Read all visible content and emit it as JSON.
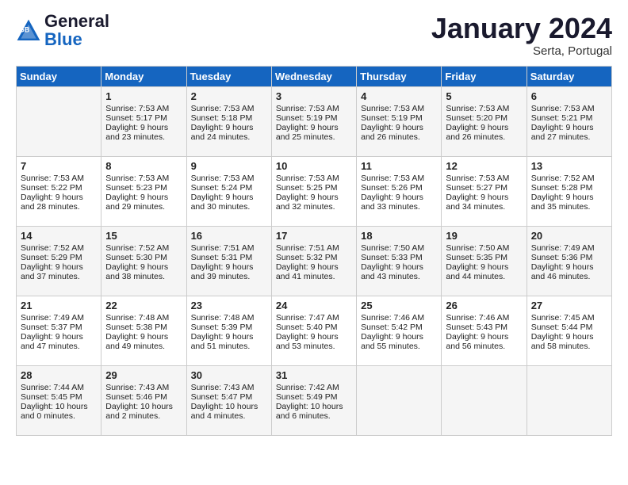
{
  "header": {
    "logo_general": "General",
    "logo_blue": "Blue",
    "month_title": "January 2024",
    "location": "Serta, Portugal"
  },
  "weekdays": [
    "Sunday",
    "Monday",
    "Tuesday",
    "Wednesday",
    "Thursday",
    "Friday",
    "Saturday"
  ],
  "weeks": [
    [
      {
        "day": "",
        "sunrise": "",
        "sunset": "",
        "daylight": ""
      },
      {
        "day": "1",
        "sunrise": "Sunrise: 7:53 AM",
        "sunset": "Sunset: 5:17 PM",
        "daylight": "Daylight: 9 hours and 23 minutes."
      },
      {
        "day": "2",
        "sunrise": "Sunrise: 7:53 AM",
        "sunset": "Sunset: 5:18 PM",
        "daylight": "Daylight: 9 hours and 24 minutes."
      },
      {
        "day": "3",
        "sunrise": "Sunrise: 7:53 AM",
        "sunset": "Sunset: 5:19 PM",
        "daylight": "Daylight: 9 hours and 25 minutes."
      },
      {
        "day": "4",
        "sunrise": "Sunrise: 7:53 AM",
        "sunset": "Sunset: 5:19 PM",
        "daylight": "Daylight: 9 hours and 26 minutes."
      },
      {
        "day": "5",
        "sunrise": "Sunrise: 7:53 AM",
        "sunset": "Sunset: 5:20 PM",
        "daylight": "Daylight: 9 hours and 26 minutes."
      },
      {
        "day": "6",
        "sunrise": "Sunrise: 7:53 AM",
        "sunset": "Sunset: 5:21 PM",
        "daylight": "Daylight: 9 hours and 27 minutes."
      }
    ],
    [
      {
        "day": "7",
        "sunrise": "Sunrise: 7:53 AM",
        "sunset": "Sunset: 5:22 PM",
        "daylight": "Daylight: 9 hours and 28 minutes."
      },
      {
        "day": "8",
        "sunrise": "Sunrise: 7:53 AM",
        "sunset": "Sunset: 5:23 PM",
        "daylight": "Daylight: 9 hours and 29 minutes."
      },
      {
        "day": "9",
        "sunrise": "Sunrise: 7:53 AM",
        "sunset": "Sunset: 5:24 PM",
        "daylight": "Daylight: 9 hours and 30 minutes."
      },
      {
        "day": "10",
        "sunrise": "Sunrise: 7:53 AM",
        "sunset": "Sunset: 5:25 PM",
        "daylight": "Daylight: 9 hours and 32 minutes."
      },
      {
        "day": "11",
        "sunrise": "Sunrise: 7:53 AM",
        "sunset": "Sunset: 5:26 PM",
        "daylight": "Daylight: 9 hours and 33 minutes."
      },
      {
        "day": "12",
        "sunrise": "Sunrise: 7:53 AM",
        "sunset": "Sunset: 5:27 PM",
        "daylight": "Daylight: 9 hours and 34 minutes."
      },
      {
        "day": "13",
        "sunrise": "Sunrise: 7:52 AM",
        "sunset": "Sunset: 5:28 PM",
        "daylight": "Daylight: 9 hours and 35 minutes."
      }
    ],
    [
      {
        "day": "14",
        "sunrise": "Sunrise: 7:52 AM",
        "sunset": "Sunset: 5:29 PM",
        "daylight": "Daylight: 9 hours and 37 minutes."
      },
      {
        "day": "15",
        "sunrise": "Sunrise: 7:52 AM",
        "sunset": "Sunset: 5:30 PM",
        "daylight": "Daylight: 9 hours and 38 minutes."
      },
      {
        "day": "16",
        "sunrise": "Sunrise: 7:51 AM",
        "sunset": "Sunset: 5:31 PM",
        "daylight": "Daylight: 9 hours and 39 minutes."
      },
      {
        "day": "17",
        "sunrise": "Sunrise: 7:51 AM",
        "sunset": "Sunset: 5:32 PM",
        "daylight": "Daylight: 9 hours and 41 minutes."
      },
      {
        "day": "18",
        "sunrise": "Sunrise: 7:50 AM",
        "sunset": "Sunset: 5:33 PM",
        "daylight": "Daylight: 9 hours and 43 minutes."
      },
      {
        "day": "19",
        "sunrise": "Sunrise: 7:50 AM",
        "sunset": "Sunset: 5:35 PM",
        "daylight": "Daylight: 9 hours and 44 minutes."
      },
      {
        "day": "20",
        "sunrise": "Sunrise: 7:49 AM",
        "sunset": "Sunset: 5:36 PM",
        "daylight": "Daylight: 9 hours and 46 minutes."
      }
    ],
    [
      {
        "day": "21",
        "sunrise": "Sunrise: 7:49 AM",
        "sunset": "Sunset: 5:37 PM",
        "daylight": "Daylight: 9 hours and 47 minutes."
      },
      {
        "day": "22",
        "sunrise": "Sunrise: 7:48 AM",
        "sunset": "Sunset: 5:38 PM",
        "daylight": "Daylight: 9 hours and 49 minutes."
      },
      {
        "day": "23",
        "sunrise": "Sunrise: 7:48 AM",
        "sunset": "Sunset: 5:39 PM",
        "daylight": "Daylight: 9 hours and 51 minutes."
      },
      {
        "day": "24",
        "sunrise": "Sunrise: 7:47 AM",
        "sunset": "Sunset: 5:40 PM",
        "daylight": "Daylight: 9 hours and 53 minutes."
      },
      {
        "day": "25",
        "sunrise": "Sunrise: 7:46 AM",
        "sunset": "Sunset: 5:42 PM",
        "daylight": "Daylight: 9 hours and 55 minutes."
      },
      {
        "day": "26",
        "sunrise": "Sunrise: 7:46 AM",
        "sunset": "Sunset: 5:43 PM",
        "daylight": "Daylight: 9 hours and 56 minutes."
      },
      {
        "day": "27",
        "sunrise": "Sunrise: 7:45 AM",
        "sunset": "Sunset: 5:44 PM",
        "daylight": "Daylight: 9 hours and 58 minutes."
      }
    ],
    [
      {
        "day": "28",
        "sunrise": "Sunrise: 7:44 AM",
        "sunset": "Sunset: 5:45 PM",
        "daylight": "Daylight: 10 hours and 0 minutes."
      },
      {
        "day": "29",
        "sunrise": "Sunrise: 7:43 AM",
        "sunset": "Sunset: 5:46 PM",
        "daylight": "Daylight: 10 hours and 2 minutes."
      },
      {
        "day": "30",
        "sunrise": "Sunrise: 7:43 AM",
        "sunset": "Sunset: 5:47 PM",
        "daylight": "Daylight: 10 hours and 4 minutes."
      },
      {
        "day": "31",
        "sunrise": "Sunrise: 7:42 AM",
        "sunset": "Sunset: 5:49 PM",
        "daylight": "Daylight: 10 hours and 6 minutes."
      },
      {
        "day": "",
        "sunrise": "",
        "sunset": "",
        "daylight": ""
      },
      {
        "day": "",
        "sunrise": "",
        "sunset": "",
        "daylight": ""
      },
      {
        "day": "",
        "sunrise": "",
        "sunset": "",
        "daylight": ""
      }
    ]
  ]
}
